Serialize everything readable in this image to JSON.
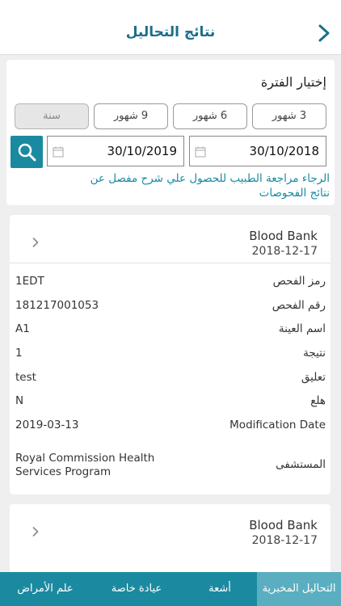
{
  "header": {
    "title": "نتائج التحاليل"
  },
  "filter": {
    "title": "إختيار الفترة",
    "periods": [
      "3 شهور",
      "6 شهور",
      "9 شهور",
      "سنة"
    ],
    "date_from": "30/10/2018",
    "date_to": "30/10/2019",
    "note": "الرجاء مراجعة الطبيب للحصول علي شرح مفصل عن نتائج الفحوصات"
  },
  "results": [
    {
      "name": "Blood Bank",
      "date": "2018-12-17",
      "fields": [
        {
          "label": "رمز الفحص",
          "value": "1EDT"
        },
        {
          "label": "رقم الفحص",
          "value": "181217001053"
        },
        {
          "label": "اسم العينة",
          "value": "A1"
        },
        {
          "label": "نتيجة",
          "value": "1"
        },
        {
          "label": "تعليق",
          "value": "test"
        },
        {
          "label": "هلع",
          "value": "N"
        },
        {
          "label": "Modification Date",
          "value": "2019-03-13"
        },
        {
          "label": "المستشفى",
          "value": "Royal Commission Health Services Program"
        }
      ]
    },
    {
      "name": "Blood Bank",
      "date": "2018-12-17"
    }
  ],
  "tabs": [
    "التحاليل المخبرية",
    "أشعة",
    "عيادة خاصة",
    "علم الأمراض"
  ],
  "colors": {
    "accent": "#1b8aa0",
    "title": "#1b6f8a",
    "active_tab": "#5aaec0"
  },
  "icons": {
    "back": "chevron-right-icon",
    "search": "search-icon",
    "calendar": "calendar-icon",
    "expand": "chevron-right-icon"
  }
}
